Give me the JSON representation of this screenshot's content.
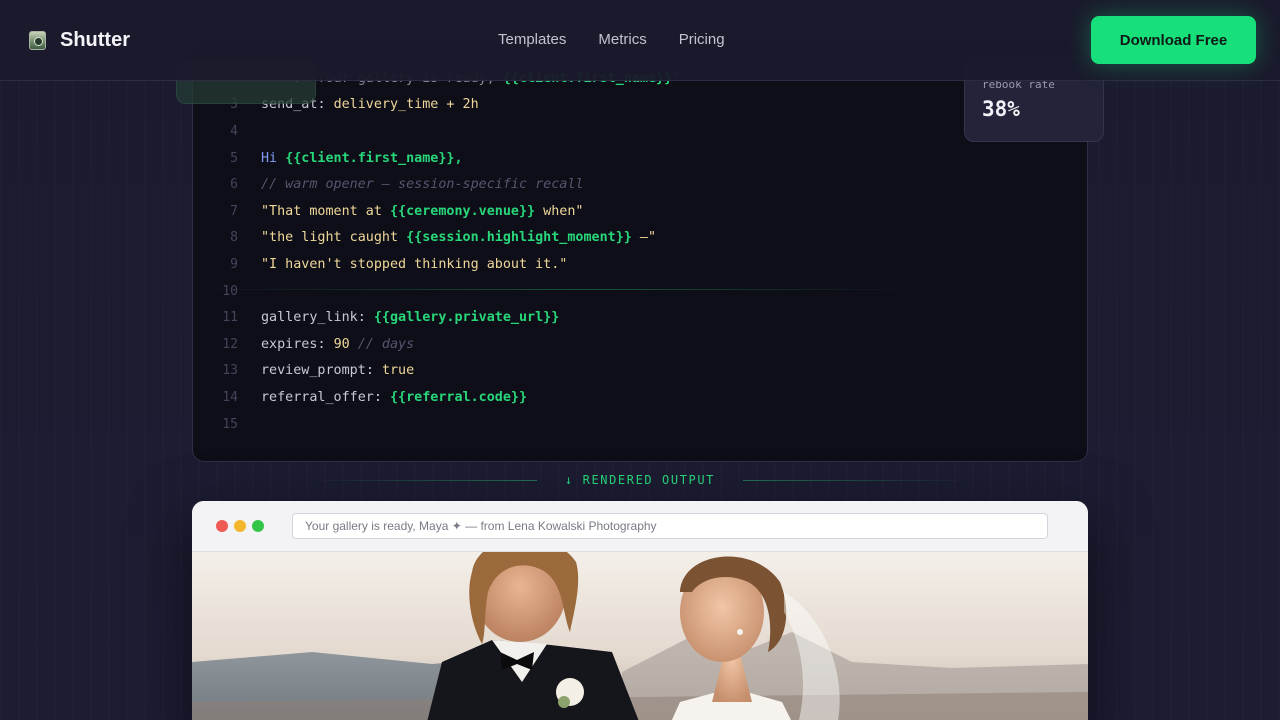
{
  "nav": {
    "brand": "Shutter",
    "links": [
      "Templates",
      "Metrics",
      "Pricing"
    ],
    "cta": "Download Free"
  },
  "stat": {
    "label": "rebook rate",
    "value": "38%"
  },
  "code": {
    "lines": [
      {
        "n": "",
        "t": [
          {
            "c": "tk-dim",
            "v": "   ': \"Your gallery is ready, "
          },
          {
            "c": "tk-var",
            "v": "{{client.first_name}}"
          },
          {
            "c": "tk-dim",
            "v": "\""
          }
        ]
      },
      {
        "n": "3",
        "t": [
          {
            "c": "tk-key",
            "v": "send_at"
          },
          {
            "c": "tk-punct",
            "v": ": "
          },
          {
            "c": "tk-val",
            "v": "delivery_time + 2h"
          }
        ]
      },
      {
        "n": "4",
        "t": []
      },
      {
        "n": "5",
        "t": [
          {
            "c": "tk-kw",
            "v": "Hi "
          },
          {
            "c": "tk-var",
            "v": "{{client.first_name}},"
          }
        ]
      },
      {
        "n": "6",
        "t": [
          {
            "c": "tk-cmt",
            "v": "// warm opener — session-specific recall"
          }
        ]
      },
      {
        "n": "7",
        "t": [
          {
            "c": "tk-str",
            "v": "\"That moment at "
          },
          {
            "c": "tk-var",
            "v": "{{ceremony.venue}}"
          },
          {
            "c": "tk-str",
            "v": " when\""
          }
        ]
      },
      {
        "n": "8",
        "t": [
          {
            "c": "tk-str",
            "v": "\"the light caught "
          },
          {
            "c": "tk-var",
            "v": "{{session.highlight_moment}}"
          },
          {
            "c": "tk-str",
            "v": " —\""
          }
        ]
      },
      {
        "n": "9",
        "t": [
          {
            "c": "tk-str",
            "v": "\"I haven't stopped thinking about it.\""
          }
        ]
      },
      {
        "n": "10",
        "t": []
      },
      {
        "n": "11",
        "t": [
          {
            "c": "tk-key",
            "v": "gallery_link"
          },
          {
            "c": "tk-punct",
            "v": ": "
          },
          {
            "c": "tk-var",
            "v": "{{gallery.private_url}}"
          }
        ]
      },
      {
        "n": "12",
        "t": [
          {
            "c": "tk-key",
            "v": "expires"
          },
          {
            "c": "tk-punct",
            "v": ": "
          },
          {
            "c": "tk-num",
            "v": "90"
          },
          {
            "c": "tk-cmt",
            "v": " // days"
          }
        ]
      },
      {
        "n": "13",
        "t": [
          {
            "c": "tk-key",
            "v": "review_prompt"
          },
          {
            "c": "tk-punct",
            "v": ": "
          },
          {
            "c": "tk-val",
            "v": "true"
          }
        ]
      },
      {
        "n": "14",
        "t": [
          {
            "c": "tk-key",
            "v": "referral_offer"
          },
          {
            "c": "tk-punct",
            "v": ": "
          },
          {
            "c": "tk-var",
            "v": "{{referral.code}}"
          }
        ]
      },
      {
        "n": "15",
        "t": []
      }
    ]
  },
  "divider": {
    "label": "↓ RENDERED OUTPUT"
  },
  "browser": {
    "address": "Your gallery is ready, Maya ✦ — from Lena Kowalski Photography"
  },
  "colors": {
    "accent": "#17e07a",
    "background": "#1b1b2f",
    "code_bg": "#0e0e18"
  }
}
